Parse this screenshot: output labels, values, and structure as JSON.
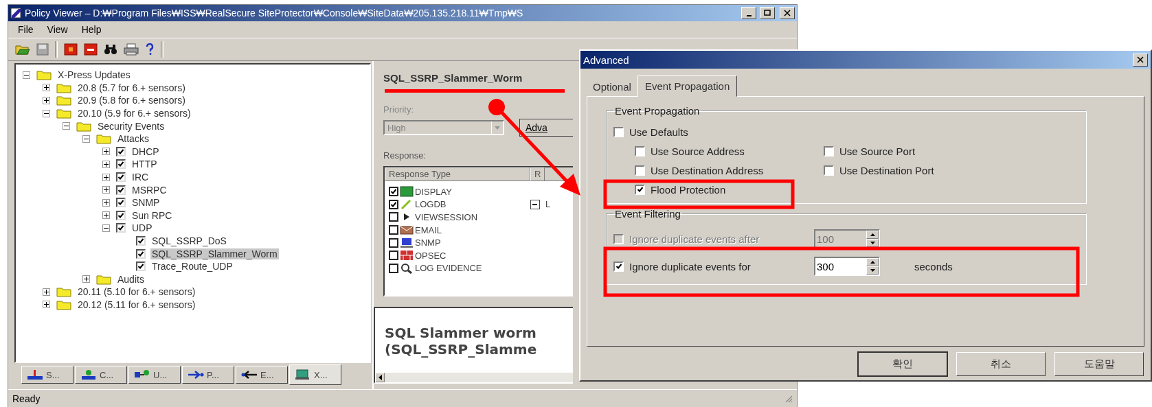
{
  "main_window": {
    "title": "Policy Viewer – D:₩Program Files₩ISS₩RealSecure SiteProtector₩Console₩SiteData₩205.135.218.11₩Tmp₩S",
    "menu": [
      "File",
      "View",
      "Help"
    ],
    "tree": [
      {
        "label": "X-Press Updates",
        "kind": "folder",
        "expanded": true,
        "selected": false,
        "children": [
          {
            "label": "20.8 (5.7 for 6.+ sensors)",
            "kind": "folder",
            "expanded": false,
            "selected": false
          },
          {
            "label": "20.9 (5.8 for 6.+ sensors)",
            "kind": "folder",
            "expanded": false,
            "selected": false
          },
          {
            "label": "20.10 (5.9 for 6.+ sensors)",
            "kind": "folder",
            "expanded": true,
            "selected": false,
            "children": [
              {
                "label": "Security Events",
                "kind": "folder",
                "expanded": true,
                "selected": false,
                "children": [
                  {
                    "label": "Attacks",
                    "kind": "folder",
                    "expanded": true,
                    "selected": false,
                    "children": [
                      {
                        "label": "DHCP",
                        "kind": "category",
                        "expanded": false,
                        "checked": true,
                        "selected": false
                      },
                      {
                        "label": "HTTP",
                        "kind": "category",
                        "expanded": false,
                        "checked": true,
                        "selected": false
                      },
                      {
                        "label": "IRC",
                        "kind": "category",
                        "expanded": false,
                        "checked": true,
                        "selected": false
                      },
                      {
                        "label": "MSRPC",
                        "kind": "category",
                        "expanded": false,
                        "checked": true,
                        "selected": false
                      },
                      {
                        "label": "SNMP",
                        "kind": "category",
                        "expanded": false,
                        "checked": true,
                        "selected": false
                      },
                      {
                        "label": "Sun RPC",
                        "kind": "category",
                        "expanded": false,
                        "checked": true,
                        "selected": false
                      },
                      {
                        "label": "UDP",
                        "kind": "category",
                        "expanded": true,
                        "checked": true,
                        "selected": false,
                        "children": [
                          {
                            "label": "SQL_SSRP_DoS",
                            "kind": "signature",
                            "checked": true,
                            "selected": false
                          },
                          {
                            "label": "SQL_SSRP_Slammer_Worm",
                            "kind": "signature",
                            "checked": true,
                            "selected": true
                          },
                          {
                            "label": "Trace_Route_UDP",
                            "kind": "signature",
                            "checked": true,
                            "selected": false
                          }
                        ]
                      }
                    ]
                  },
                  {
                    "label": "Audits",
                    "kind": "folder",
                    "expanded": false,
                    "selected": false
                  }
                ]
              }
            ]
          },
          {
            "label": "20.11 (5.10 for 6.+ sensors)",
            "kind": "folder",
            "expanded": false,
            "selected": false
          },
          {
            "label": "20.12 (5.11 for 6.+ sensors)",
            "kind": "folder",
            "expanded": false,
            "selected": false
          }
        ]
      }
    ],
    "bottom_tabs": [
      {
        "label": "S...",
        "selected": false
      },
      {
        "label": "C...",
        "selected": false
      },
      {
        "label": "U...",
        "selected": false
      },
      {
        "label": "P...",
        "selected": false
      },
      {
        "label": "E...",
        "selected": false
      },
      {
        "label": "X...",
        "selected": true
      }
    ],
    "detail": {
      "signature": "SQL_SSRP_Slammer_Worm",
      "priority_label": "Priority:",
      "priority": "High",
      "priority_disabled": true,
      "advanced_button": "Adva",
      "response_label": "Response:",
      "columns": [
        "Response Type",
        "R"
      ],
      "responses": [
        {
          "label": "DISPLAY",
          "checked": true
        },
        {
          "label": "LOGDB",
          "checked": true,
          "column_2": "L"
        },
        {
          "label": "VIEWSESSION",
          "checked": false
        },
        {
          "label": "EMAIL",
          "checked": false
        },
        {
          "label": "SNMP",
          "checked": false
        },
        {
          "label": "OPSEC",
          "checked": false
        },
        {
          "label": "LOG EVIDENCE",
          "checked": false
        }
      ]
    },
    "description": [
      "SQL Slammer worm",
      "(SQL_SSRP_Slamme"
    ],
    "status_bar": "Ready"
  },
  "dialog": {
    "title": "Advanced",
    "tabs": [
      {
        "label": "Optional",
        "selected": false
      },
      {
        "label": "Event Propagation",
        "selected": true
      }
    ],
    "propagation": {
      "title": "Event Propagation",
      "rows": [
        [
          {
            "label": "Use Defaults",
            "checked": false
          }
        ],
        [
          {
            "label": "Use Source Address",
            "checked": false
          },
          {
            "label": "Use Source Port",
            "checked": false
          }
        ],
        [
          {
            "label": "Use Destination Address",
            "checked": false
          },
          {
            "label": "Use Destination Port",
            "checked": false
          }
        ],
        [
          {
            "label": "Flood Protection",
            "checked": true
          }
        ]
      ]
    },
    "filtering": {
      "title": "Event Filtering",
      "rows": [
        {
          "label": "Ignore duplicate events after",
          "checked": false,
          "disabled": true,
          "value": "100"
        },
        {
          "label": "Ignore duplicate events for",
          "checked": true,
          "disabled": false,
          "value": "300",
          "unit": "seconds"
        }
      ]
    },
    "buttons": [
      {
        "label": "확인",
        "default": true
      },
      {
        "label": "취소",
        "default": false
      },
      {
        "label": "도움말",
        "default": false
      }
    ]
  }
}
